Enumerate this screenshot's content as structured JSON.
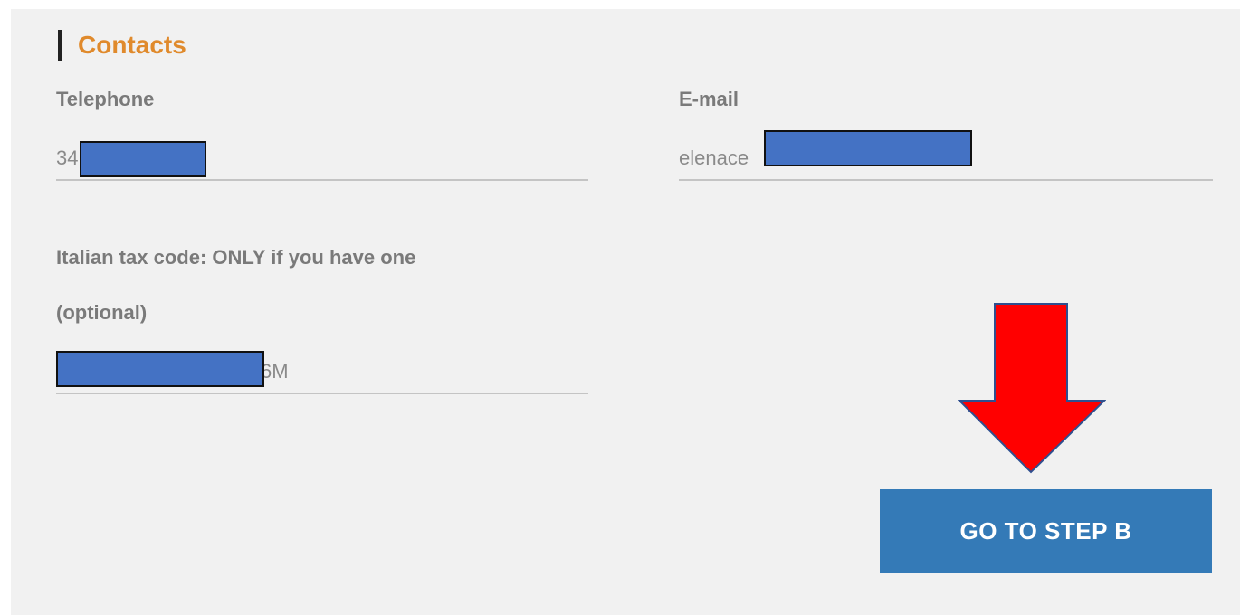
{
  "contacts": {
    "section_title": "Contacts",
    "telephone": {
      "label": "Telephone",
      "value": "34"
    },
    "email": {
      "label": "E-mail",
      "value": "elenace"
    },
    "tax_code": {
      "label_line1": "Italian tax code: ONLY if you have one",
      "label_line2": "(optional)",
      "value": "6M"
    }
  },
  "actions": {
    "next_label": "GO TO STEP B"
  },
  "colors": {
    "accent_title": "#e08a2c",
    "button_bg": "#347ab7",
    "arrow_fill": "#ff0000",
    "redaction_fill": "#4472c4",
    "panel_bg": "#f1f1f1"
  }
}
